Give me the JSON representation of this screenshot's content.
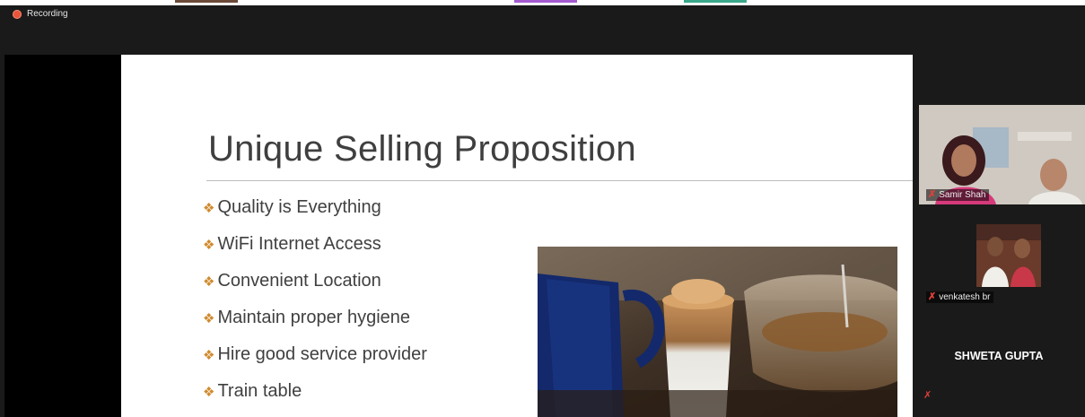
{
  "recording": {
    "label": "Recording"
  },
  "slide": {
    "title": "Unique Selling Proposition",
    "bullet_glyph": "❖",
    "bullets": [
      "Quality is Everything",
      "WiFi Internet Access",
      "Convenient Location",
      "Maintain proper hygiene",
      "Hire good service provider",
      "Train table"
    ]
  },
  "participants": [
    {
      "name": "Samir Shah",
      "muted": true
    },
    {
      "name": "venkatesh br",
      "muted": true
    },
    {
      "name": "SHWETA GUPTA",
      "muted": true
    }
  ],
  "icons": {
    "recording": "recording-dot-icon",
    "muted": "mic-muted-icon",
    "bullet": "diamond-bullet-icon"
  },
  "colors": {
    "bullet": "#d08a2e",
    "muted_mic": "#e0403a",
    "recording": "#e8553a"
  }
}
